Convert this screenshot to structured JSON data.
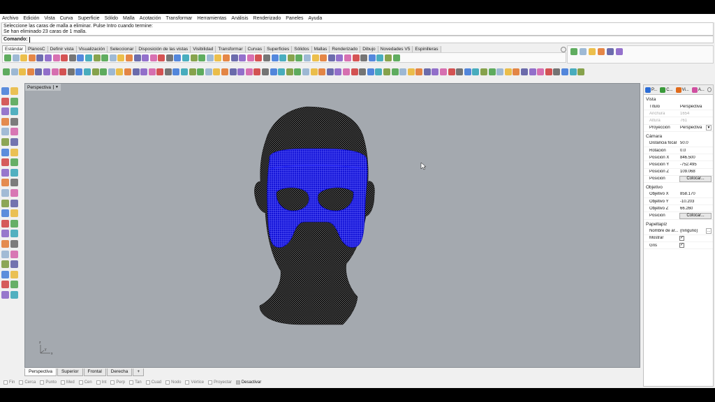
{
  "menu": [
    "Archivo",
    "Edición",
    "Vista",
    "Curva",
    "Superficie",
    "Sólido",
    "Malla",
    "Acotación",
    "Transformar",
    "Herramientas",
    "Análisis",
    "Renderizado",
    "Paneles",
    "Ayuda"
  ],
  "command_history": [
    "Seleccione las caras de malla a eliminar. Pulse Intro cuando termine:",
    "Se han eliminado 23 caras de 1 malla."
  ],
  "command_prompt": "Comando:",
  "toolbar_tabs": [
    "Estándar",
    "PlanosC",
    "Definir vista",
    "Visualización",
    "Seleccionar",
    "Disposición de las vistas",
    "Visibilidad",
    "Transformar",
    "Curvas",
    "Superficies",
    "Sólidos",
    "Mallas",
    "Renderizado",
    "Dibujo",
    "Novedades V5",
    "Espinilleras"
  ],
  "viewport": {
    "title": "Perspectiva",
    "background": "#a4a9af",
    "mask_color": "#1414d8",
    "axis_labels": [
      "z",
      "y",
      "x"
    ]
  },
  "view_tabs": [
    "Perspectiva",
    "Superior",
    "Frontal",
    "Derecha"
  ],
  "osnaps": [
    {
      "label": "Fin",
      "on": false
    },
    {
      "label": "Cerca",
      "on": false
    },
    {
      "label": "Punto",
      "on": false
    },
    {
      "label": "Med",
      "on": false
    },
    {
      "label": "Cen",
      "on": false
    },
    {
      "label": "Int",
      "on": false
    },
    {
      "label": "Perp",
      "on": false
    },
    {
      "label": "Tan",
      "on": false
    },
    {
      "label": "Cuad",
      "on": false
    },
    {
      "label": "Nodo",
      "on": false
    },
    {
      "label": "Vértice",
      "on": false
    },
    {
      "label": "Proyectar",
      "on": false
    },
    {
      "label": "Desactivar",
      "on": true
    }
  ],
  "panel": {
    "tabs": [
      {
        "label": "P...",
        "icon": "properties-icon"
      },
      {
        "label": "C...",
        "icon": "layers-icon"
      },
      {
        "label": "Vi...",
        "icon": "display-icon"
      },
      {
        "label": "A...",
        "icon": "help-icon"
      }
    ],
    "sections": [
      {
        "title": "Vista",
        "rows": [
          {
            "label": "Título",
            "value": "Perspectiva"
          },
          {
            "label": "Anchura",
            "value": "1654",
            "disabled": true
          },
          {
            "label": "Altura",
            "value": "761",
            "disabled": true
          },
          {
            "label": "Proyección",
            "value": "Perspectiva",
            "dropdown": true
          }
        ]
      },
      {
        "title": "Cámara",
        "rows": [
          {
            "label": "Distancia focal",
            "value": "50.0"
          },
          {
            "label": "Rotación",
            "value": "0.0"
          },
          {
            "label": "Posición X",
            "value": "846.500"
          },
          {
            "label": "Posición Y",
            "value": "-752.495"
          },
          {
            "label": "Posición Z",
            "value": "109.068"
          },
          {
            "label": "Posición",
            "button": "Colocar..."
          }
        ]
      },
      {
        "title": "Objetivo",
        "rows": [
          {
            "label": "Objetivo X",
            "value": "858.170"
          },
          {
            "label": "Objetivo Y",
            "value": "-10.203"
          },
          {
            "label": "Objetivo Z",
            "value": "66.260"
          },
          {
            "label": "Posición",
            "button": "Colocar..."
          }
        ]
      },
      {
        "title": "Papeltapiz",
        "rows": [
          {
            "label": "Nombre de ar...",
            "value": "(ninguno)",
            "more": true
          },
          {
            "label": "Mostrar",
            "check": true
          },
          {
            "label": "Gris",
            "check": true
          }
        ]
      }
    ]
  }
}
